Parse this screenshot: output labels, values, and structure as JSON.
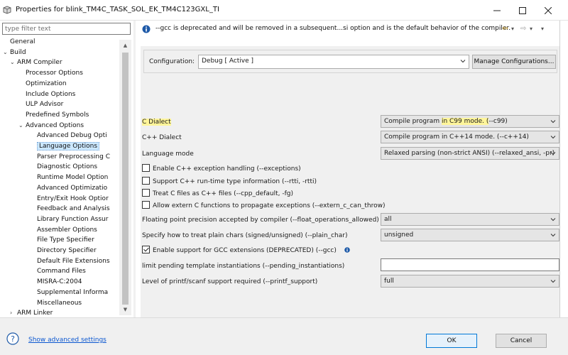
{
  "window": {
    "title": "Properties for blink_TM4C_TASK_SOL_EK_TM4C123GXL_TI",
    "minimize_glyph": "—",
    "maximize_glyph": "☐",
    "close_glyph": "✕"
  },
  "filter": {
    "placeholder": "type filter text",
    "value": ""
  },
  "tree": {
    "items": [
      {
        "label": "General",
        "level": 0,
        "arrow": ""
      },
      {
        "label": "Build",
        "level": 0,
        "arrow": "⌄"
      },
      {
        "label": "ARM Compiler",
        "level": 1,
        "arrow": "⌄"
      },
      {
        "label": "Processor Options",
        "level": 2,
        "arrow": ""
      },
      {
        "label": "Optimization",
        "level": 2,
        "arrow": ""
      },
      {
        "label": "Include Options",
        "level": 2,
        "arrow": ""
      },
      {
        "label": "ULP Advisor",
        "level": 2,
        "arrow": ""
      },
      {
        "label": "Predefined Symbols",
        "level": 2,
        "arrow": ""
      },
      {
        "label": "Advanced Options",
        "level": 2,
        "arrow": "⌄"
      },
      {
        "label": "Advanced Debug Opti",
        "level": 3,
        "arrow": ""
      },
      {
        "label": "Language Options",
        "level": 3,
        "arrow": "",
        "selected": true
      },
      {
        "label": "Parser Preprocessing C",
        "level": 3,
        "arrow": ""
      },
      {
        "label": "Diagnostic Options",
        "level": 3,
        "arrow": ""
      },
      {
        "label": "Runtime Model Option",
        "level": 3,
        "arrow": ""
      },
      {
        "label": "Advanced Optimizatio",
        "level": 3,
        "arrow": ""
      },
      {
        "label": "Entry/Exit Hook Optior",
        "level": 3,
        "arrow": ""
      },
      {
        "label": "Feedback and Analysis",
        "level": 3,
        "arrow": ""
      },
      {
        "label": "Library Function Assur",
        "level": 3,
        "arrow": ""
      },
      {
        "label": "Assembler Options",
        "level": 3,
        "arrow": ""
      },
      {
        "label": "File Type Specifier",
        "level": 3,
        "arrow": ""
      },
      {
        "label": "Directory Specifier",
        "level": 3,
        "arrow": ""
      },
      {
        "label": "Default File Extensions",
        "level": 3,
        "arrow": ""
      },
      {
        "label": "Command Files",
        "level": 3,
        "arrow": ""
      },
      {
        "label": "MISRA-C:2004",
        "level": 3,
        "arrow": ""
      },
      {
        "label": "Supplemental Informa",
        "level": 3,
        "arrow": ""
      },
      {
        "label": "Miscellaneous",
        "level": 3,
        "arrow": ""
      },
      {
        "label": "ARM Linker",
        "level": 1,
        "arrow": "›"
      }
    ]
  },
  "message": "--gcc is deprecated and will be removed in a subsequent...si option and is the default behavior of the compiler.",
  "nav": {
    "back": "⇦",
    "back_menu": "▾",
    "forward": "⇨",
    "forward_menu": "▾",
    "view_menu": "▾"
  },
  "configuration": {
    "label": "Configuration:",
    "value": "Debug  [ Active ]",
    "manage_label": "Manage Configurations..."
  },
  "options": {
    "c_dialect": {
      "label": "C Dialect",
      "value_pre": "Compile program ",
      "value_hl": "in C99 mode. (",
      "value_post": "--c99)"
    },
    "cpp_dialect": {
      "label": "C++ Dialect",
      "value": "Compile program in C++14 mode. (--c++14)"
    },
    "language_mode": {
      "label": "Language mode",
      "value": "Relaxed parsing (non-strict ANSI) (--relaxed_ansi, -pr)"
    },
    "checkboxes": [
      {
        "label": "Enable C++ exception handling (--exceptions)",
        "checked": false
      },
      {
        "label": "Support C++ run-time type information (--rtti, -rtti)",
        "checked": false
      },
      {
        "label": "Treat C files as C++ files (--cpp_default, -fg)",
        "checked": false
      },
      {
        "label": "Allow extern C functions to propagate exceptions (--extern_c_can_throw)",
        "checked": false
      }
    ],
    "float_ops": {
      "label": "Floating point precision accepted by compiler (--float_operations_allowed)",
      "value": "all"
    },
    "plain_char": {
      "label": "Specify how to treat plain chars (signed/unsigned) (--plain_char)",
      "value": "unsigned"
    },
    "gcc": {
      "label": "Enable support for GCC extensions (DEPRECATED) (--gcc)",
      "checked": true
    },
    "pending_inst": {
      "label": "limit pending template instantiations (--pending_instantiations)",
      "value": ""
    },
    "printf": {
      "label": "Level of printf/scanf support required (--printf_support)",
      "value": "full"
    }
  },
  "bottom": {
    "advanced_link": "Show advanced settings",
    "ok_label": "OK",
    "cancel_label": "Cancel"
  },
  "colors": {
    "highlight": "#fff59a",
    "selection": "#cce8ff",
    "link": "#0b57d0",
    "info_blue": "#1e5aa8"
  }
}
